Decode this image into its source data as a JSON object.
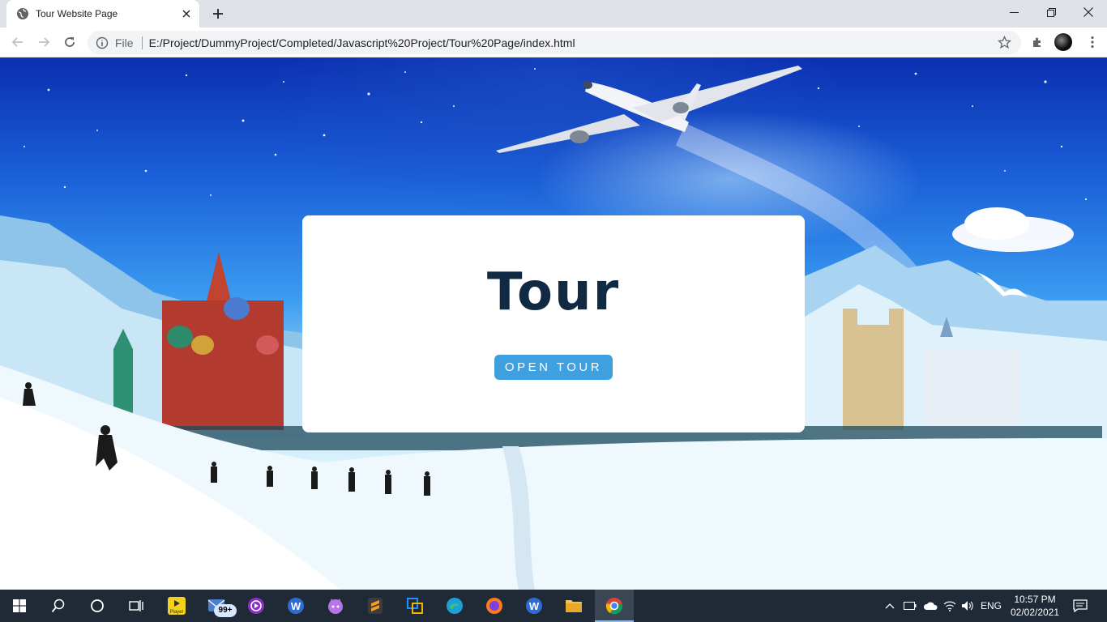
{
  "browser": {
    "tab": {
      "title": "Tour Website Page",
      "favicon": "globe-icon"
    },
    "window_controls": [
      "minimize-icon",
      "restore-icon",
      "close-icon"
    ],
    "toolbar": {
      "scheme_label": "File",
      "url": "E:/Project/DummyProject/Completed/Javascript%20Project/Tour%20Page/index.html"
    }
  },
  "page": {
    "card": {
      "title": "Tour",
      "button_label": "OPEN TOUR"
    },
    "colors": {
      "title": "#102a43",
      "button": "#3fa0e0",
      "card_bg": "#ffffff"
    }
  },
  "taskbar": {
    "apps": [
      "windows-start-icon",
      "search-icon",
      "cortana-icon",
      "task-view-icon",
      "player-app-icon",
      "mail-app-icon",
      "media-app-icon",
      "wps-writer-icon",
      "cat-app-icon",
      "sublime-text-icon",
      "virtualbox-icon",
      "edge-icon",
      "firefox-icon",
      "wps-writer-icon",
      "file-explorer-icon",
      "chrome-icon"
    ],
    "player_label": "Player",
    "mail_badge": "99+",
    "language": "ENG",
    "time": "10:57 PM",
    "date": "02/02/2021"
  }
}
